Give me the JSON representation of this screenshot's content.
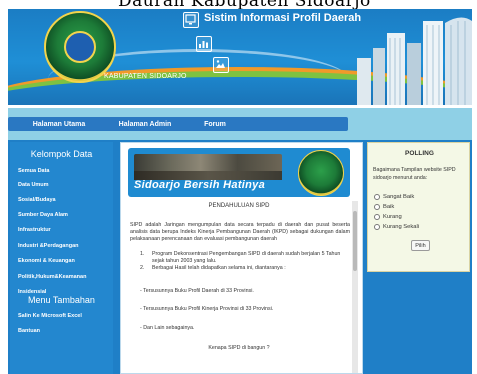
{
  "page": {
    "cut_title_fragment": "Dauran Kabupaten Sidoarjo"
  },
  "header": {
    "site_title": "Sistim Informasi Profil Daerah",
    "kabupaten": "KABUPATEN SIDOARJO",
    "icons": [
      "monitor-icon",
      "chart-icon",
      "image-icon"
    ]
  },
  "nav": {
    "items": [
      "Halaman Utama",
      "Halaman Admin",
      "Forum"
    ]
  },
  "sidebar": {
    "heading_1": "Kelompok Data",
    "items_1": [
      "Semua Data",
      "Data Umum",
      "Sosial/Budaya",
      "Sumber Daya Alam",
      "Infrastruktur",
      "Industri &Perdagangan",
      "Ekonomi & Keuangan",
      "Politik,Hukum&Keamanan",
      "Insidensial"
    ],
    "heading_2": "Menu Tambahan",
    "items_2": [
      "Salin Ke Microsoft Excel",
      "Bantuan"
    ]
  },
  "banner": {
    "caption": "Sidoarjo Bersih Hatinya"
  },
  "article": {
    "title": "PENDAHULUAN SIPD",
    "paragraph": "SIPD adalah Jaringan mengumpulan data secara terpadu di daerah dan pusat beserta analisis data berupa Indeks Kinerja Pembangunan Daerah (IKPD) sebagai dukungan dalam pelaksanaan perencanaan dan evaluasi pembangunan daerah",
    "list": [
      {
        "num": "1.",
        "text": "Program Dekonsentrasi Pengembangan SIPD di daerah sudah berjalan 5 Tahun sejak tahun 2003 yang lalu."
      },
      {
        "num": "2.",
        "text": "Berbagai Hasil telah didapatkan selama ini, diantaranya :"
      }
    ],
    "bullets": [
      "- Tersusunnya Buku Profil Daerah di 33 Provinsi.",
      "- Tersusunnya Buku Profil Kinerja Provinsi di 33 Provinsi.",
      "- Dan Lain sebagainya."
    ],
    "question": "Kenapa SIPD di bangun ?"
  },
  "poll": {
    "title": "POLLING",
    "question": "Bagaimana Tampilan website SIPD sidoarjo menurut anda:",
    "options": [
      "Sangat Baik",
      "Baik",
      "Kurang",
      "Kurang Sekali"
    ],
    "button": "Pilih"
  }
}
